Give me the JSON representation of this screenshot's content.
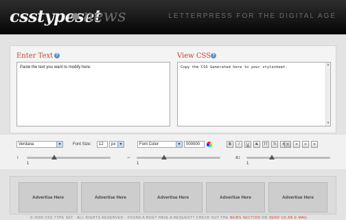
{
  "header": {
    "logo": "csstypeset",
    "logo_sub": "news",
    "tagline": "LETTERPRESS FOR THE DIGITAL AGE"
  },
  "editor": {
    "left": {
      "title": "Enter Text",
      "placeholder": "Paste the text you want to modify here."
    },
    "right": {
      "title": "View CSS",
      "placeholder": "Copy the CSS Generated here to your stylesheet."
    }
  },
  "toolbar": {
    "font_family": "Verdana",
    "font_size_label": "Font Size:",
    "font_size_value": "12",
    "font_size_unit": "px",
    "font_color_label": "Font Color",
    "font_color_value": "000000",
    "format_buttons": [
      "B",
      "I",
      "U",
      "S",
      "TT",
      "Tt",
      "tt",
      "≡",
      "≡",
      "≡",
      "≡"
    ],
    "sliders": [
      {
        "icon": "↕",
        "value": "1",
        "level": 0.33
      },
      {
        "icon": "⇔",
        "value": "1",
        "level": 0.33
      },
      {
        "icon": "a↕",
        "value": "1",
        "level": 0.3
      }
    ]
  },
  "ads": [
    "Advertise Here",
    "Advertise Here",
    "Advertise Here",
    "Advertise Here",
    "Advertise Here"
  ],
  "footer": {
    "text": "© 2009 CSS TYPE SET  ·  ALL RIGHTS RESERVED  ·  FOUND A BUG? HAVE A REQUEST? CHECK OUT THE",
    "link1": "NEWS SECTION",
    "mid": "OR",
    "link2": "SEND US AN E-MAIL"
  }
}
